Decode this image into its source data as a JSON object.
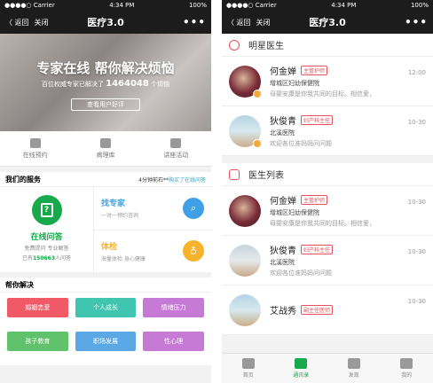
{
  "status": {
    "carrier": "●●●●○ Carrier",
    "time": "4:34 PM",
    "battery": "100%"
  },
  "nav": {
    "back": "〈 返回",
    "close": "关闭",
    "title": "医疗3.0",
    "more": "•••"
  },
  "left": {
    "banner": {
      "title": "专家在线 帮你解决烦恼",
      "sub_prefix": "百位权威专家已解决了",
      "count": "1464048",
      "sub_suffix": "个烦恼",
      "button": "查看用户好评"
    },
    "quick": [
      {
        "label": "在线预约"
      },
      {
        "label": "病理库"
      },
      {
        "label": "讲座活动"
      }
    ],
    "services_title": "我们的服务",
    "recent_prefix": "4分钟前石**",
    "recent_highlight": "购买了在线问答",
    "online_qa": {
      "title": "在线问答",
      "desc": "免费提问 专业解答",
      "served_prefix": "已有",
      "served_count": "150663",
      "served_suffix": "人问答"
    },
    "find_expert": {
      "title": "找专家",
      "desc": "一对一预约咨询"
    },
    "checkup": {
      "title": "体检",
      "desc": "海量体检 身心健康"
    },
    "help_title": "帮你解决",
    "tags": [
      {
        "label": "婚姻恋爱",
        "color": "#ef5a66"
      },
      {
        "label": "个人成长",
        "color": "#41c5b1"
      },
      {
        "label": "情绪压力",
        "color": "#c67ad6"
      },
      {
        "label": "孩子教育",
        "color": "#60c36b"
      },
      {
        "label": "职场发展",
        "color": "#5aa9e6"
      },
      {
        "label": "性心理",
        "color": "#c67ad6"
      }
    ]
  },
  "right": {
    "star_title": "明星医生",
    "list_title": "医生列表",
    "doctors_star": [
      {
        "name": "何金婵",
        "tag": "主管护师",
        "hospital": "增城区妇幼保健院",
        "desc": "母婴安康是你我共同的目标。相信爱，",
        "time": "12:00"
      },
      {
        "name": "狄俊青",
        "tag": "妇产科主任",
        "hospital": "北溪医院",
        "desc": "欢迎各位准妈妈问问题",
        "time": "10-30"
      }
    ],
    "doctors_list": [
      {
        "name": "何金婵",
        "tag": "主管护师",
        "hospital": "增城区妇幼保健院",
        "desc": "母婴安康是你我共同的目标。相信爱，",
        "time": "10-30"
      },
      {
        "name": "狄俊青",
        "tag": "妇产科主任",
        "hospital": "北溪医院",
        "desc": "欢迎各位准妈妈问问题",
        "time": "10-30"
      },
      {
        "name": "艾战秀",
        "tag": "副主任医师",
        "hospital": "",
        "desc": "",
        "time": "10-30"
      }
    ],
    "tabs": [
      {
        "label": "首页"
      },
      {
        "label": "通讯录"
      },
      {
        "label": "发现"
      },
      {
        "label": "我的"
      }
    ]
  },
  "colors": {
    "green": "#17a94b",
    "blue": "#3fa0e6",
    "orange": "#f6b32b",
    "red": "#e6525c"
  }
}
